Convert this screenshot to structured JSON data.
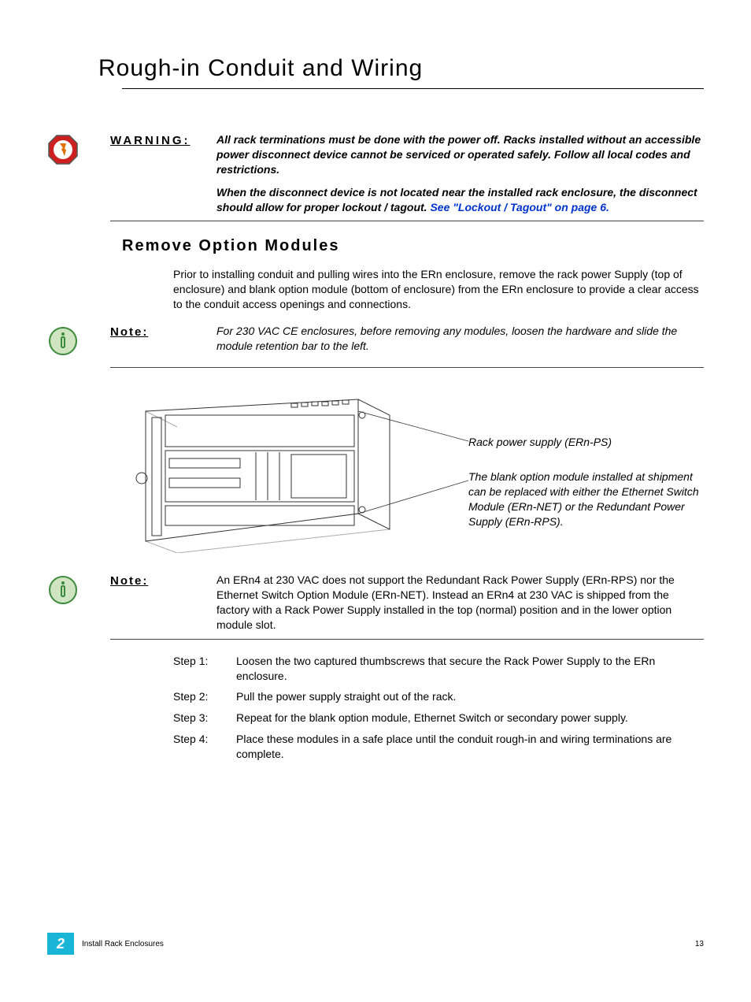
{
  "title": "Rough-in Conduit and Wiring",
  "warning": {
    "label": "WARNING:",
    "para1": "All rack terminations must be done with the power off. Racks installed without an accessible power disconnect device cannot be serviced or operated safely. Follow all local codes and restrictions.",
    "para2_a": "When the disconnect device is not located near the installed rack enclosure, the disconnect should allow for proper lockout / tagout. ",
    "para2_link": "See \"Lockout / Tagout\" on page 6."
  },
  "subsection": "Remove Option Modules",
  "intro": "Prior to installing conduit and pulling wires into the ERn enclosure, remove the rack power Supply (top of enclosure) and blank option module (bottom of enclosure) from the ERn enclosure to provide a clear access to the conduit access openings and connections.",
  "note1": {
    "label": "Note:",
    "text": "For 230 VAC CE enclosures, before removing any modules, loosen the hardware and slide the module retention bar to the left."
  },
  "figure": {
    "annot1": "Rack power supply (ERn-PS)",
    "annot2": "The blank option module installed at shipment can be replaced with either the Ethernet Switch Module (ERn-NET) or the Redundant Power Supply (ERn-RPS)."
  },
  "note2": {
    "label": "Note:",
    "text": "An ERn4 at 230 VAC does not support the Redundant Rack Power Supply (ERn-RPS) nor the Ethernet Switch Option Module (ERn-NET). Instead an ERn4 at 230 VAC is shipped from the factory with a Rack Power Supply installed in the top (normal) position and in the lower option module slot."
  },
  "steps": [
    {
      "label": "Step 1:",
      "text": "Loosen the two captured thumbscrews that secure the Rack Power Supply to the ERn enclosure."
    },
    {
      "label": "Step 2:",
      "text": "Pull the power supply straight out of the rack."
    },
    {
      "label": "Step 3:",
      "text": "Repeat for the blank option module, Ethernet Switch or secondary power supply."
    },
    {
      "label": "Step 4:",
      "text": "Place these modules in a safe place until the conduit rough-in and wiring terminations are complete."
    }
  ],
  "footer": {
    "chapter": "2",
    "left": "Install Rack Enclosures",
    "right": "13"
  }
}
